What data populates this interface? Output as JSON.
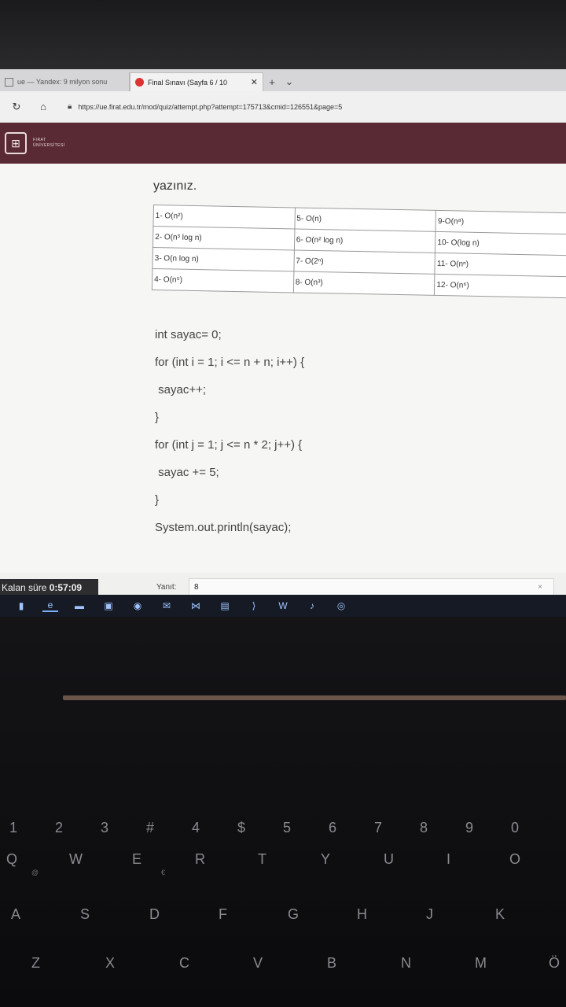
{
  "browser": {
    "tabs": [
      {
        "title": "ue — Yandex: 9 milyon sonu",
        "active": false
      },
      {
        "title": "Final Sınavı (Sayfa 6 / 10",
        "active": true
      }
    ],
    "new_tab": "+",
    "menu": "⌄",
    "url": "https://ue.firat.edu.tr/mod/quiz/attempt.php?attempt=175713&cmid=126551&page=5"
  },
  "site": {
    "logo_line1": "FIRAT",
    "logo_line2": "ÜNİVERSİTESİ"
  },
  "question": {
    "tail_text": "yazınız.",
    "table": [
      [
        "1- O(n²)",
        "5- O(n)",
        "9-O(n⁸)"
      ],
      [
        "2- O(n³ log n)",
        "6- O(n² log n)",
        "10- O(log n)"
      ],
      [
        "3- O(n log n)",
        "7- O(2ⁿ)",
        "11- O(nⁿ)"
      ],
      [
        "4- O(n⁵)",
        "8- O(n³)",
        "12- O(n⁶)"
      ]
    ],
    "code": [
      "int sayac= 0;",
      "for (int i = 1; i <= n + n; i++) {",
      " sayac++;",
      "}",
      "for (int j = 1; j <= n * 2; j++) {",
      " sayac += 5;",
      "}",
      "System.out.println(sayac);"
    ]
  },
  "timer": {
    "label": "Kalan süre",
    "value": "0:57:09"
  },
  "answer": {
    "label": "Yanıt:",
    "value": "8"
  },
  "keyboard": {
    "num_row": [
      "1",
      "2",
      "3",
      "#",
      "4",
      "$",
      "5",
      "6",
      "7",
      "8",
      "9",
      "0"
    ],
    "row1": [
      "Q",
      "W",
      "E",
      "R",
      "T",
      "Y",
      "U",
      "I",
      "O"
    ],
    "row2": [
      "A",
      "S",
      "D",
      "F",
      "G",
      "H",
      "J",
      "K"
    ],
    "row3": [
      "Z",
      "X",
      "C",
      "V",
      "B",
      "N",
      "M",
      "Ö"
    ],
    "extras": [
      "@",
      "€"
    ]
  }
}
